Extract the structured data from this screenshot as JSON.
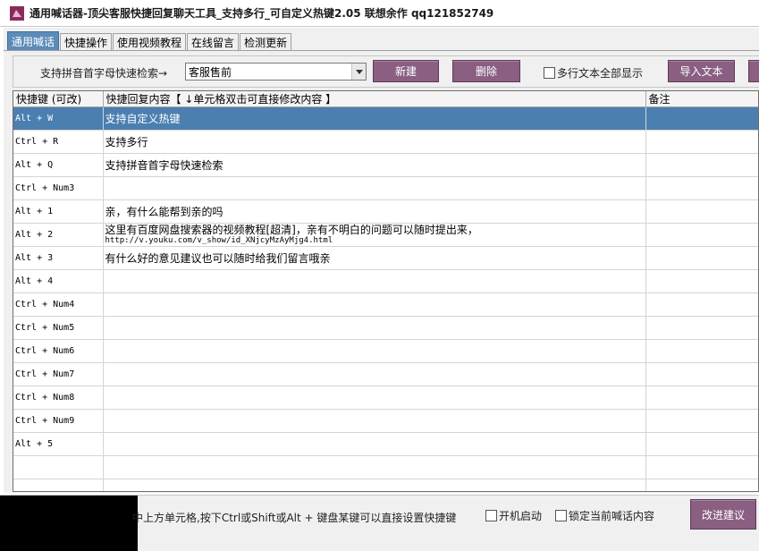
{
  "window": {
    "title": "通用喊话器-顶尖客服快捷回复聊天工具_支持多行_可自定义热键2.05  联想余作  qq121852749",
    "icon": "app-icon"
  },
  "tabs": [
    {
      "label": "通用喊话",
      "active": true
    },
    {
      "label": "快捷操作",
      "active": false
    },
    {
      "label": "使用视频教程",
      "active": false
    },
    {
      "label": "在线留言",
      "active": false
    },
    {
      "label": "检测更新",
      "active": false
    }
  ],
  "toolbar": {
    "search_label": "支持拼音首字母快速检索→",
    "combo_value": "客服售前",
    "new_label": "新建",
    "delete_label": "删除",
    "multiline_label": "多行文本全部显示",
    "import_label": "导入文本"
  },
  "table": {
    "headers": [
      "快捷键 (可改)",
      "快捷回复内容【 ↓单元格双击可直接修改内容 】",
      "备注"
    ],
    "rows": [
      {
        "key": "Alt + W",
        "content": "支持自定义热键",
        "note": "",
        "selected": true
      },
      {
        "key": "Ctrl + R",
        "content": "支持多行",
        "note": ""
      },
      {
        "key": "Alt + Q",
        "content": "支持拼音首字母快速检索",
        "note": ""
      },
      {
        "key": "Ctrl + Num3",
        "content": "",
        "note": ""
      },
      {
        "key": "Alt + 1",
        "content": "亲，有什么能帮到亲的吗",
        "note": ""
      },
      {
        "key": "Alt + 2",
        "content": "这里有百度网盘搜索器的视频教程[超清]，亲有不明白的问题可以随时提出来，",
        "content2": "http://v.youku.com/v_show/id_XNjcyMzAyMjg4.html",
        "note": ""
      },
      {
        "key": "Alt + 3",
        "content": "有什么好的意见建议也可以随时给我们留言哦亲",
        "note": ""
      },
      {
        "key": "Alt + 4",
        "content": "",
        "note": ""
      },
      {
        "key": "Ctrl + Num4",
        "content": "",
        "note": ""
      },
      {
        "key": "Ctrl + Num5",
        "content": "",
        "note": ""
      },
      {
        "key": "Ctrl + Num6",
        "content": "",
        "note": ""
      },
      {
        "key": "Ctrl + Num7",
        "content": "",
        "note": ""
      },
      {
        "key": "Ctrl + Num8",
        "content": "",
        "note": ""
      },
      {
        "key": "Ctrl + Num9",
        "content": "",
        "note": ""
      },
      {
        "key": "Alt + 5",
        "content": "",
        "note": ""
      },
      {
        "key": "",
        "content": "",
        "note": ""
      },
      {
        "key": "",
        "content": "",
        "note": ""
      }
    ]
  },
  "status": {
    "hint": "中上方单元格,按下Ctrl或Shift或Alt + 键盘某键可以直接设置快捷键",
    "autostart_label": "开机启动",
    "lock_label": "锁定当前喊话内容",
    "suggest_label": "改进建议"
  },
  "colors": {
    "selected_row": "#4a7fb0",
    "button": "#8a5f82",
    "active_tab": "#5c8bb8"
  }
}
